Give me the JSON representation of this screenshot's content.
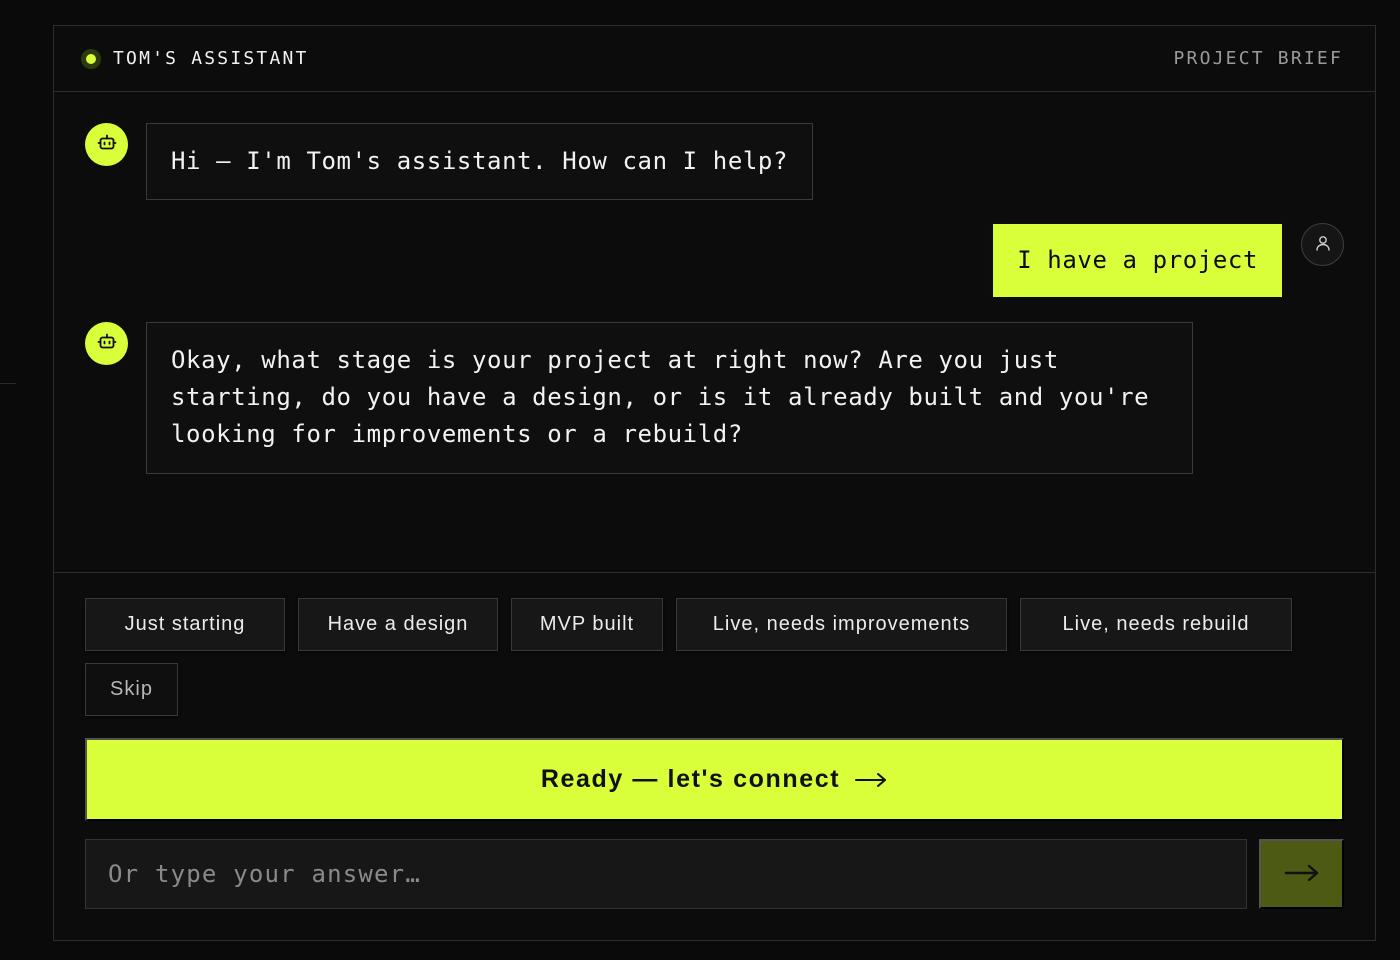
{
  "header": {
    "title": "TOM'S ASSISTANT",
    "right_label": "PROJECT BRIEF"
  },
  "messages": [
    {
      "sender": "bot",
      "text": "Hi — I'm Tom's assistant. How can I help?"
    },
    {
      "sender": "user",
      "text": "I have a project"
    },
    {
      "sender": "bot",
      "text": "Okay, what stage is your project at right now? Are you just starting, do you have a design, or is it already built and you're looking for improvements or a rebuild?"
    }
  ],
  "quick_replies": [
    "Just starting",
    "Have a design",
    "MVP built",
    "Live, needs improvements",
    "Live, needs rebuild",
    "Skip"
  ],
  "cta": {
    "label": "Ready — let's connect"
  },
  "composer": {
    "placeholder": "Or type your answer…"
  },
  "icons": {
    "status": "status-dot-icon",
    "bot": "robot-icon",
    "user": "user-icon",
    "cta": "arrow-right-icon",
    "send": "arrow-right-icon"
  },
  "colors": {
    "accent": "#d8ff3a",
    "send_button": "#4d5a14",
    "background": "#0a0a0a",
    "panel": "#0c0c0c",
    "border": "#2d2d2d"
  }
}
